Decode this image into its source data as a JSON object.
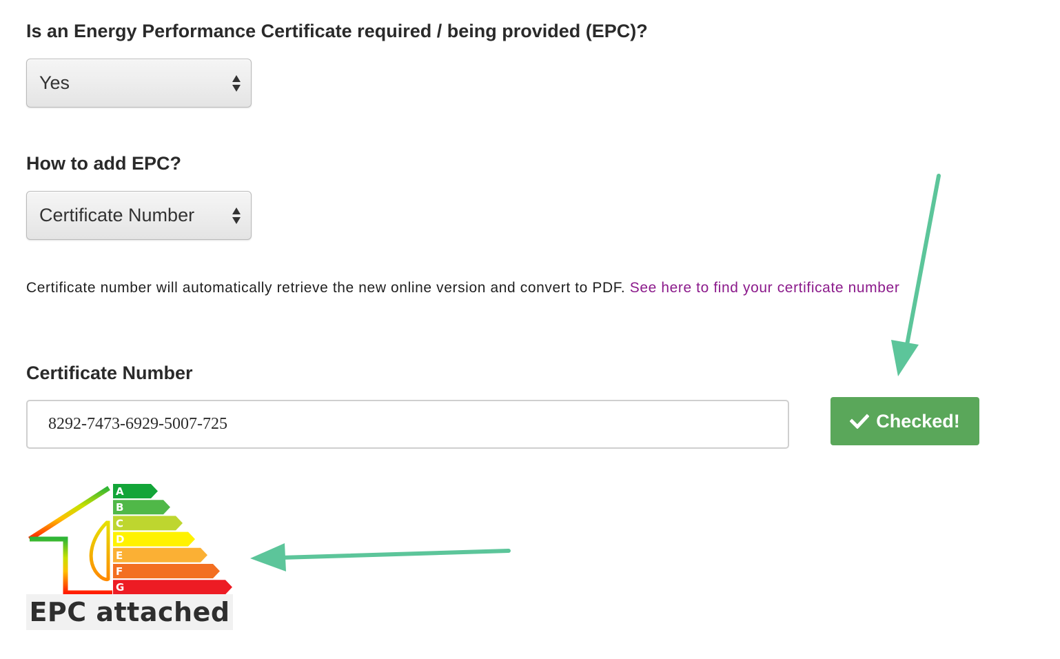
{
  "epc_required": {
    "question": "Is an Energy Performance Certificate required / being provided (EPC)?",
    "selected": "Yes"
  },
  "how_to_add": {
    "question": "How to add EPC?",
    "selected": "Certificate Number"
  },
  "info": {
    "text": "Certificate number will automatically retrieve the new online version and convert to PDF. ",
    "link_text": "See here to find your certificate number"
  },
  "certificate": {
    "label": "Certificate Number",
    "value": "8292-7473-6929-5007-725",
    "check_button_label": "Checked!"
  },
  "epc_badge": {
    "bands": [
      "A",
      "B",
      "C",
      "D",
      "E",
      "F",
      "G"
    ],
    "band_colors": [
      "#13a538",
      "#50b848",
      "#bed62f",
      "#fff200",
      "#fbb034",
      "#f36f21",
      "#ed1c24"
    ],
    "caption": "EPC attached"
  },
  "colors": {
    "button_green": "#5aa75a",
    "link_purple": "#8b1a8b",
    "annotation_arrow": "#5cc59a"
  },
  "icons": {
    "check": "check-icon",
    "select_arrows": "up-down-arrows-icon"
  }
}
